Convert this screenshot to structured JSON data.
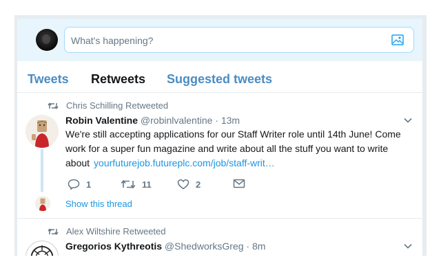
{
  "compose": {
    "placeholder": "What's happening?"
  },
  "tabs": [
    {
      "label": "Tweets",
      "active": false
    },
    {
      "label": "Retweets",
      "active": true
    },
    {
      "label": "Suggested tweets",
      "active": false
    }
  ],
  "tweets": [
    {
      "retweeted_by": "Chris Schilling Retweeted",
      "name": "Robin Valentine",
      "handle": "@robinlvalentine",
      "dot": "·",
      "time": "13m",
      "text": "We're still accepting applications for our Staff Writer role until 14th June! Come work for a super fun magazine and write about all the stuff you want to write about",
      "link": "yourfuturejob.futureplc.com/job/staff-writ…",
      "replies": "1",
      "retweets": "11",
      "likes": "2",
      "show_thread": "Show this thread"
    },
    {
      "retweeted_by": "Alex Wiltshire Retweeted",
      "name": "Gregorios Kythreotis",
      "handle": "@ShedworksGreg",
      "dot": "·",
      "time": "8m"
    }
  ],
  "colors": {
    "accent": "#1b95e0",
    "tab_inactive": "#4a8cc4",
    "muted": "#657786",
    "compose_bg": "#e8f5fd"
  }
}
